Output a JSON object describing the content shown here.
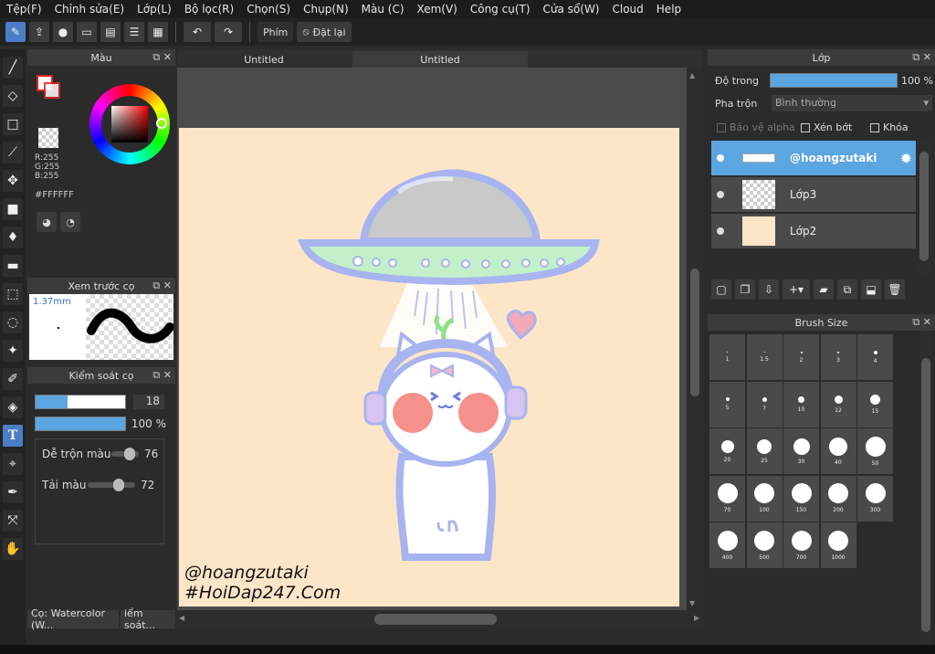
{
  "menu": [
    "Tệp(F)",
    "Chỉnh sửa(E)",
    "Lớp(L)",
    "Bộ lọc(R)",
    "Chọn(S)",
    "Chụp(N)",
    "Màu (C)",
    "Xem(V)",
    "Công cụ(T)",
    "Cửa sổ(W)",
    "Cloud",
    "Help"
  ],
  "toolbar": {
    "key_label": "Phím",
    "reset_label": "Đặt lại"
  },
  "canvas_tabs": [
    "Untitled",
    "Untitled"
  ],
  "color_panel": {
    "title": "Màu",
    "r": "R:255",
    "g": "G:255",
    "b": "B:255",
    "hex": "#FFFFFF"
  },
  "brush_preview": {
    "title": "Xem trước cọ",
    "size": "1.37mm"
  },
  "brush_control": {
    "title": "Kiểm soát cọ",
    "size_value": "18",
    "opacity_value": "100 %",
    "blend_label": "Dễ trộn màu",
    "blend_value": "76",
    "load_label": "Tải màu",
    "load_value": "72"
  },
  "bottom_tabs": [
    "Cọ: Watercolor (W...",
    "iểm soát..."
  ],
  "layer_panel": {
    "title": "Lớp",
    "opacity_label": "Độ trong",
    "opacity_value": "100 %",
    "blend_label": "Pha trộn",
    "blend_mode": "Bình thường",
    "protect_alpha": "Bảo vệ alpha",
    "clip": "Xén bớt",
    "lock": "Khóa",
    "layers": [
      "@hoangzutaki",
      "Lớp3",
      "Lớp2"
    ]
  },
  "brush_size_panel": {
    "title": "Brush Size",
    "sizes": [
      "1",
      "1.5",
      "2",
      "3",
      "4",
      "5",
      "7",
      "10",
      "12",
      "15",
      "20",
      "25",
      "30",
      "40",
      "50",
      "70",
      "100",
      "150",
      "200",
      "300",
      "400",
      "500",
      "700",
      "1000"
    ]
  },
  "watermark": {
    "line1": "@hoangzutaki",
    "line2": "#HoiDap247.Com"
  },
  "colors": {
    "accent": "#4a7fc7",
    "layer_selected": "#5ba6e0",
    "canvas_bg": "#fde6c8",
    "line_art": "#a8b4f0"
  }
}
